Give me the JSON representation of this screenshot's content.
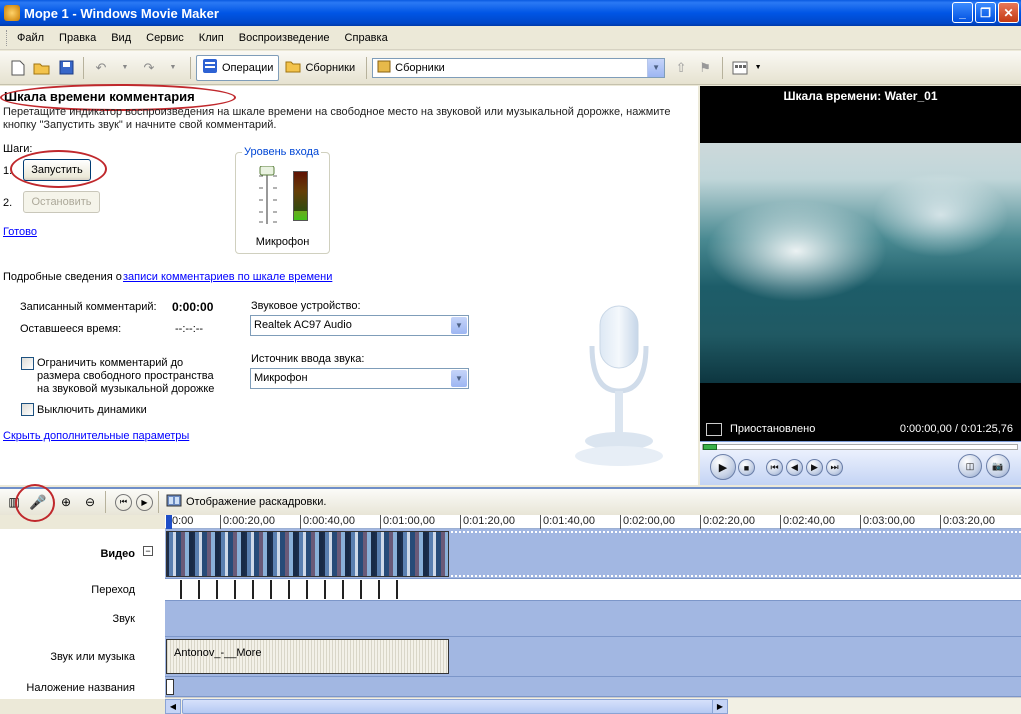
{
  "window": {
    "title": "Море 1 - Windows Movie Maker",
    "btn_min": "_",
    "btn_max": "❐",
    "btn_close": "✕"
  },
  "menu": [
    "Файл",
    "Правка",
    "Вид",
    "Сервис",
    "Клип",
    "Воспроизведение",
    "Справка"
  ],
  "toolbar": {
    "operations_label": "Операции",
    "collections_label": "Сборники",
    "collections_combo": "Сборники"
  },
  "narration": {
    "title": "Шкала времени комментария",
    "description": "Перетащите индикатор воспроизведения на шкале времени на свободное место на звуковой или музыкальной дорожке, нажмите кнопку \"Запустить звук\" и начните свой комментарий.",
    "steps_label": "Шаги:",
    "step1_num": "1.",
    "step2_num": "2.",
    "start_button": "Запустить",
    "stop_button": "Остановить",
    "done_link": "Готово",
    "input_level_title": "Уровень входа",
    "microphone_label": "Микрофон",
    "details_prefix": "Подробные сведения о ",
    "details_link": "записи комментариев по шкале времени",
    "recorded_label": "Записанный комментарий:",
    "recorded_value": "0:00:00",
    "remaining_label": "Оставшееся время:",
    "remaining_value": "--:--:--",
    "audio_device_label": "Звуковое устройство:",
    "audio_device_value": "Realtek AC97 Audio",
    "input_source_label": "Источник ввода звука:",
    "input_source_value": "Микрофон",
    "limit_checkbox_label": "Ограничить комментарий до размера свободного пространства на звуковой музыкальной дорожке",
    "mute_checkbox_label": "Выключить динамики",
    "hide_options_link": "Скрыть дополнительные параметры"
  },
  "preview": {
    "title": "Шкала времени: Water_01",
    "status": "Приостановлено",
    "time": "0:00:00,00 / 0:01:25,76"
  },
  "timeline": {
    "storyboard_label": "Отображение раскадровки.",
    "ruler": [
      "0:00",
      "0:00:20,00",
      "0:00:40,00",
      "0:01:00,00",
      "0:01:20,00",
      "0:01:40,00",
      "0:02:00,00",
      "0:02:20,00",
      "0:02:40,00",
      "0:03:00,00",
      "0:03:20,00"
    ],
    "tracks": {
      "video": "Видео",
      "video_toggle": "−",
      "transition": "Переход",
      "audio": "Звук",
      "audio_music": "Звук или музыка",
      "title_overlay": "Наложение названия"
    },
    "music_clip": "Antonov_-__More"
  },
  "colors": {
    "accent": "#0055e5",
    "link": "#0000ff",
    "track": "#a2b7e2",
    "highlight": "#c0282c"
  }
}
